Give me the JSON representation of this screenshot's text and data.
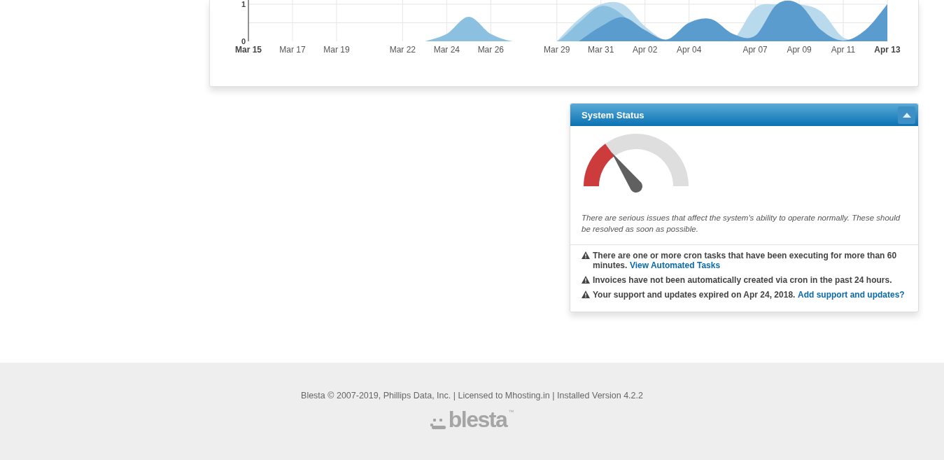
{
  "activity_chart": {
    "chart_data": {
      "type": "area",
      "categories": [
        "Mar 15",
        null,
        "Mar 17",
        null,
        "Mar 19",
        null,
        null,
        "Mar 22",
        null,
        "Mar 24",
        null,
        "Mar 26",
        null,
        null,
        "Mar 29",
        null,
        "Mar 31",
        null,
        "Apr 02",
        null,
        "Apr 04",
        null,
        null,
        "Apr 07",
        null,
        "Apr 09",
        null,
        "Apr 11",
        null,
        "Apr 13"
      ],
      "series": [
        {
          "color": "#b9d9ec",
          "values": [
            null,
            null,
            null,
            null,
            null,
            null,
            null,
            null,
            null,
            null,
            null,
            null,
            null,
            null,
            0,
            0.6,
            1,
            1,
            0.4,
            0,
            0,
            0,
            0.05,
            0.9,
            1,
            1,
            0.8,
            0.1,
            0,
            null
          ]
        },
        {
          "color": "#8cc0e0",
          "values": [
            null,
            null,
            null,
            null,
            null,
            null,
            null,
            null,
            0,
            0.2,
            0.66,
            0.2,
            0,
            0,
            0,
            0.5,
            0.95,
            0.7,
            0,
            null,
            null,
            null,
            null,
            null,
            null,
            null,
            null,
            null,
            null,
            null
          ]
        },
        {
          "color": "#5b9ccf",
          "values": [
            null,
            null,
            null,
            null,
            null,
            null,
            null,
            null,
            null,
            null,
            null,
            null,
            null,
            null,
            null,
            0,
            0.4,
            0.65,
            0.3,
            0.05,
            0.5,
            0.6,
            0.2,
            0.15,
            1,
            1,
            0.3,
            0.02,
            0.3,
            1
          ]
        }
      ],
      "ylim": [
        0,
        1
      ],
      "yticks": [
        0,
        1
      ],
      "grid": true
    }
  },
  "system_status": {
    "title": "System Status",
    "gauge": {
      "level": 0.3
    },
    "summary": "There are serious issues that affect the system's ability to operate normally. These should be resolved as soon as possible.",
    "alerts": [
      {
        "text": "There are one or more cron tasks that have been executing for more than 60 minutes.",
        "link": "View Automated Tasks"
      },
      {
        "text": "Invoices have not been automatically created via cron in the past 24 hours."
      },
      {
        "text": "Your support and updates expired on Apr 24, 2018.",
        "link": "Add support and updates?"
      }
    ]
  },
  "footer": {
    "text": "Blesta © 2007-2019, Phillips Data, Inc. | Licensed to Mhosting.in | Installed Version 4.2.2",
    "logo": {
      "word": "blesta",
      "mark": "™"
    }
  }
}
